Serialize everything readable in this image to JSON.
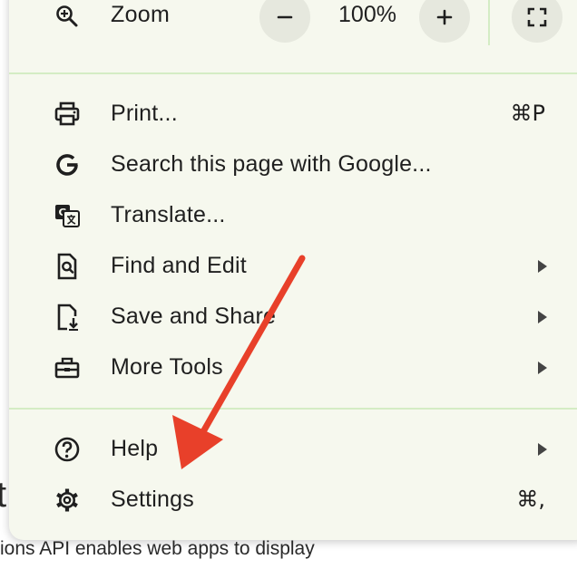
{
  "background": {
    "partial_letter": "t",
    "partial_line": "ions API enables web apps to display"
  },
  "zoom": {
    "label": "Zoom",
    "value": "100%",
    "minus_icon": "minus-icon",
    "plus_icon": "plus-icon",
    "fullscreen_icon": "fullscreen-icon",
    "icon": "zoom-in-icon"
  },
  "menu": {
    "items": [
      {
        "label": "Print...",
        "shortcut": "⌘P",
        "icon": "printer-icon"
      },
      {
        "label": "Search this page with Google...",
        "shortcut": "",
        "icon": "google-icon"
      },
      {
        "label": "Translate...",
        "shortcut": "",
        "icon": "translate-icon"
      },
      {
        "label": "Find and Edit",
        "shortcut": "",
        "icon": "find-page-icon",
        "submenu": true
      },
      {
        "label": "Save and Share",
        "shortcut": "",
        "icon": "save-page-icon",
        "submenu": true
      },
      {
        "label": "More Tools",
        "shortcut": "",
        "icon": "toolbox-icon",
        "submenu": true
      },
      {
        "label": "Help",
        "shortcut": "",
        "icon": "help-icon",
        "submenu": true
      },
      {
        "label": "Settings",
        "shortcut": "⌘,",
        "icon": "gear-icon"
      }
    ]
  },
  "annotation": {
    "arrow_color": "#e8402a"
  },
  "colors": {
    "menu_background": "#f6f8ee",
    "separator": "#d4ecc4",
    "button_background": "#e6e8de",
    "text": "#1f1f1f"
  }
}
